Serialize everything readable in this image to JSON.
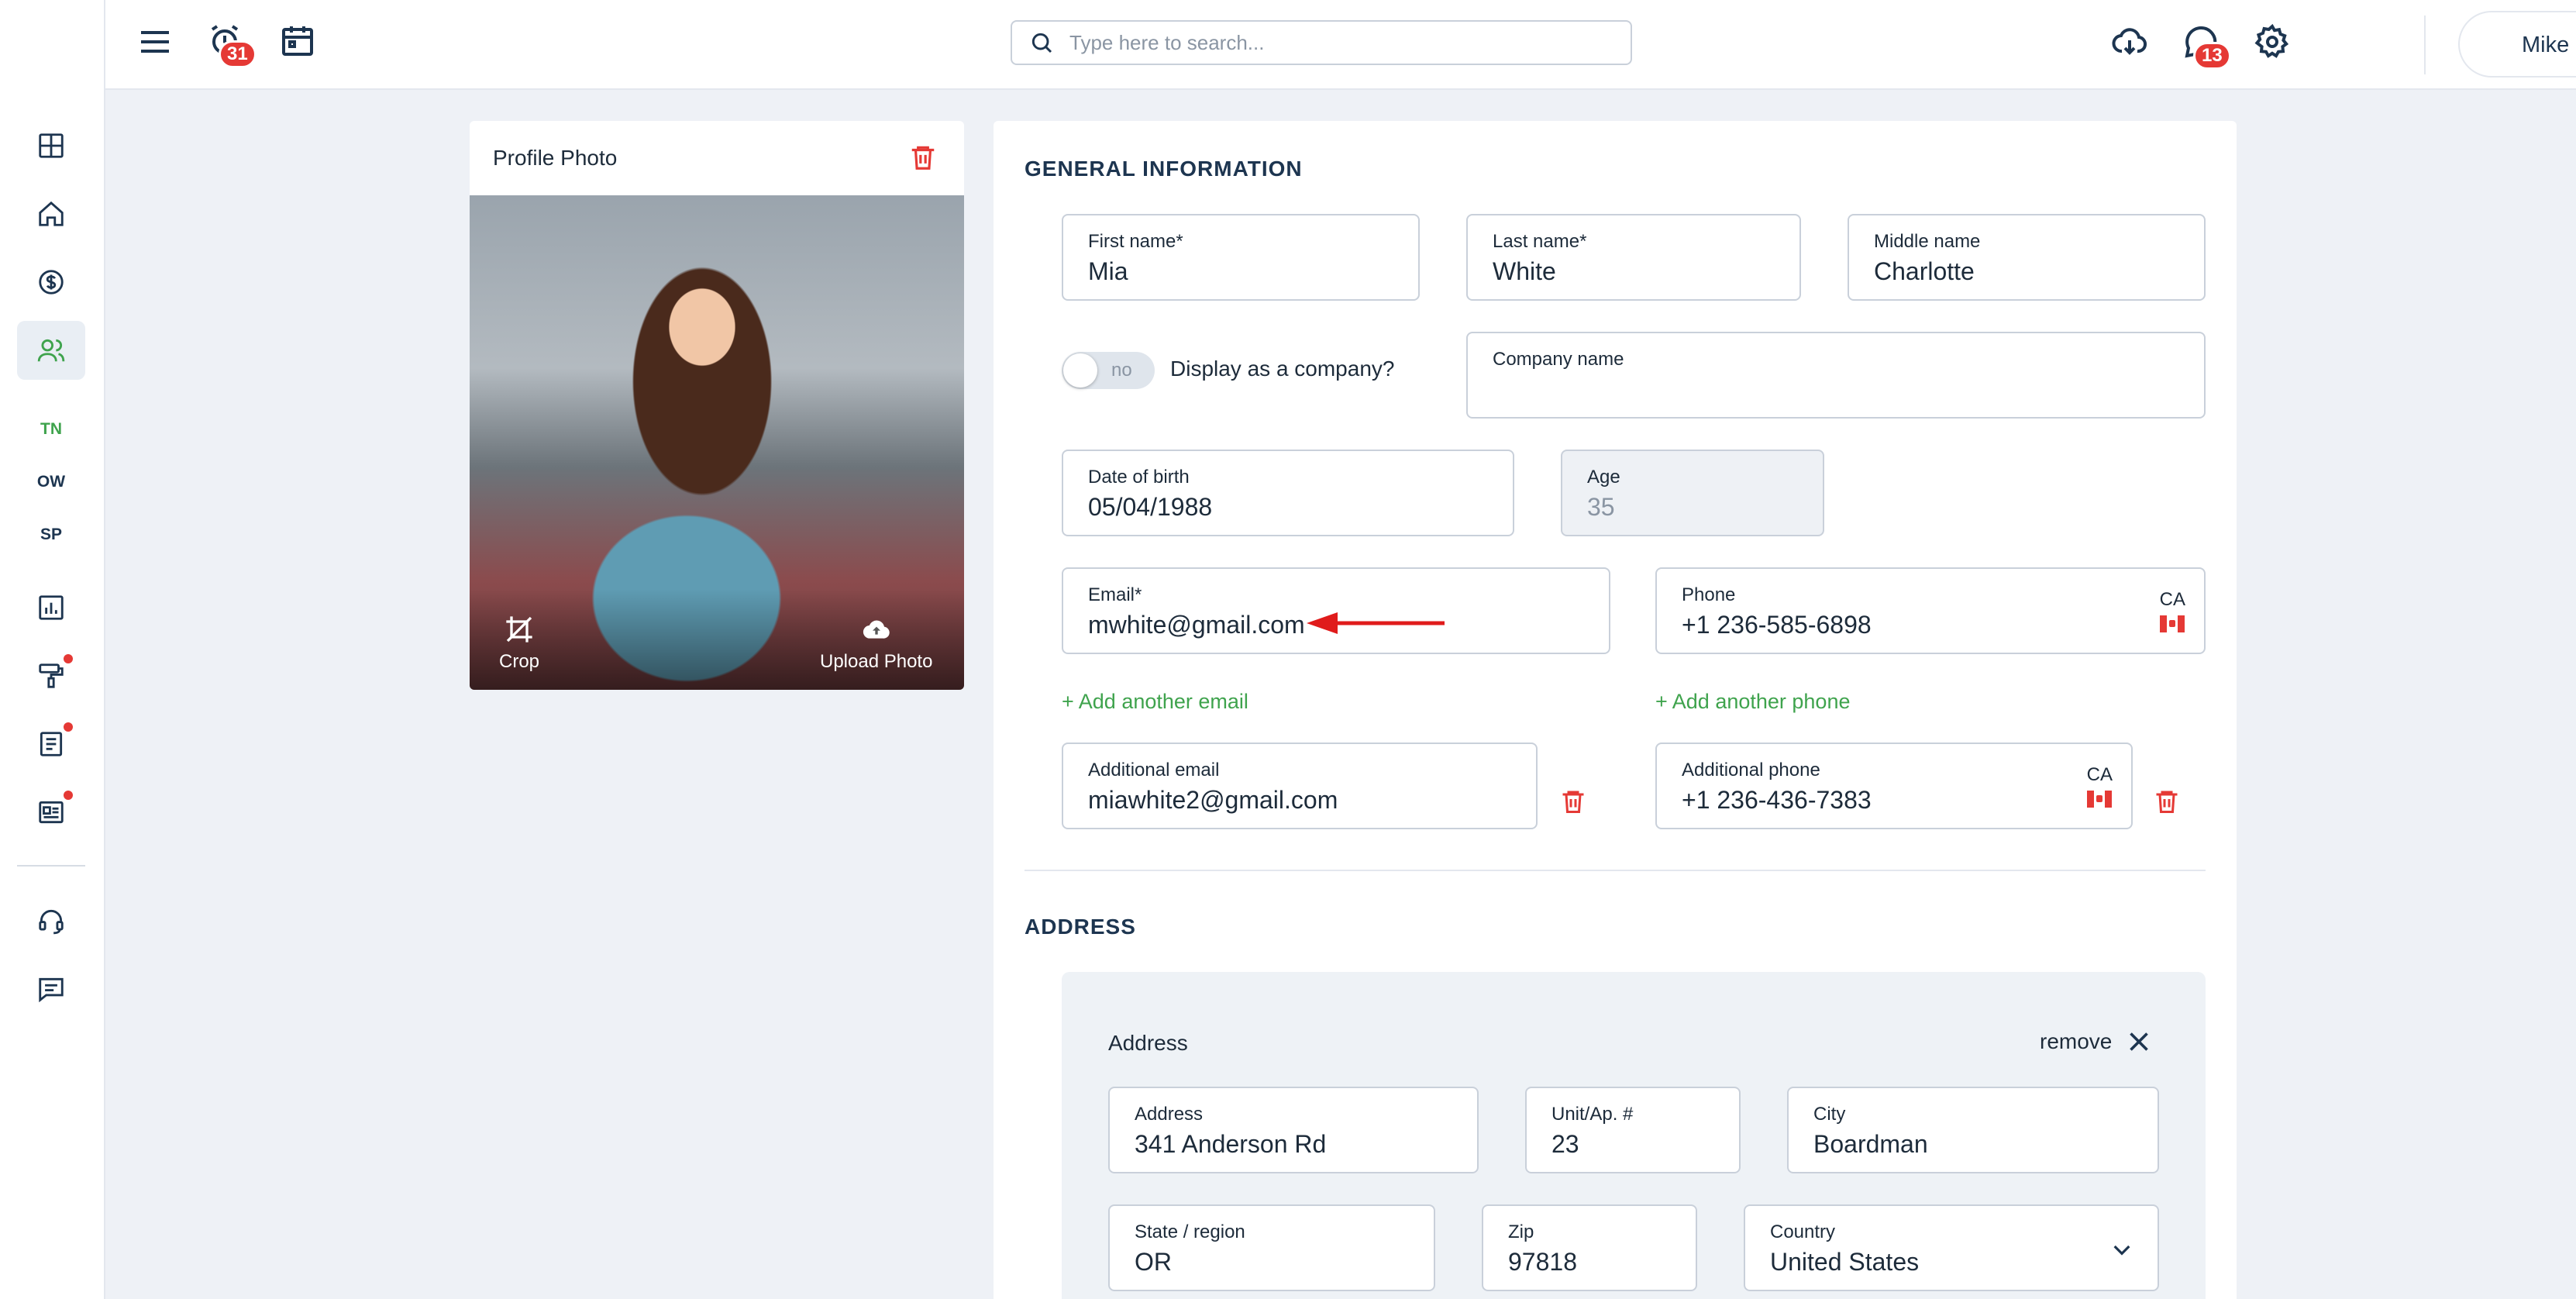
{
  "sidebar": {
    "items": [
      "dashboard-icon",
      "home-icon",
      "dollar-icon",
      "users-icon",
      "reports-icon",
      "paint-roller-icon",
      "document-icon",
      "newspaper-icon",
      "headset-icon",
      "chat-icon"
    ],
    "tags": [
      "TN",
      "OW",
      "SP"
    ]
  },
  "topbar": {
    "alarm_badge": "31",
    "chat_badge": "13",
    "search_placeholder": "Type here to search...",
    "user_name": "Mike"
  },
  "photo_card": {
    "title": "Profile Photo",
    "crop_label": "Crop",
    "upload_label": "Upload Photo"
  },
  "general": {
    "section_title": "GENERAL INFORMATION",
    "first_name": {
      "label": "First name*",
      "value": "Mia"
    },
    "last_name": {
      "label": "Last name*",
      "value": "White"
    },
    "middle_name": {
      "label": "Middle name",
      "value": "Charlotte"
    },
    "company_toggle": {
      "state": "no",
      "label": "Display as a company?"
    },
    "company_name": {
      "label": "Company name",
      "value": ""
    },
    "dob": {
      "label": "Date of birth",
      "value": "05/04/1988"
    },
    "age": {
      "label": "Age",
      "value": "35"
    },
    "email": {
      "label": "Email*",
      "value": "mwhite@gmail.com"
    },
    "phone": {
      "label": "Phone",
      "value": "+1 236-585-6898",
      "country": "CA"
    },
    "add_email": "+ Add another email",
    "add_phone": "+ Add another phone",
    "additional_email": {
      "label": "Additional email",
      "value": "miawhite2@gmail.com"
    },
    "additional_phone": {
      "label": "Additional phone",
      "value": "+1 236-436-7383",
      "country": "CA"
    }
  },
  "address": {
    "section_title": "ADDRESS",
    "block_title": "Address",
    "remove_label": "remove",
    "street": {
      "label": "Address",
      "value": "341 Anderson Rd"
    },
    "unit": {
      "label": "Unit/Ap. #",
      "value": "23"
    },
    "city": {
      "label": "City",
      "value": "Boardman"
    },
    "state": {
      "label": "State / region",
      "value": "OR"
    },
    "zip": {
      "label": "Zip",
      "value": "97818"
    },
    "country": {
      "label": "Country",
      "value": "United States"
    }
  },
  "colors": {
    "accent_green": "#3fa34d",
    "danger_red": "#e53935",
    "navy": "#1d3550"
  }
}
